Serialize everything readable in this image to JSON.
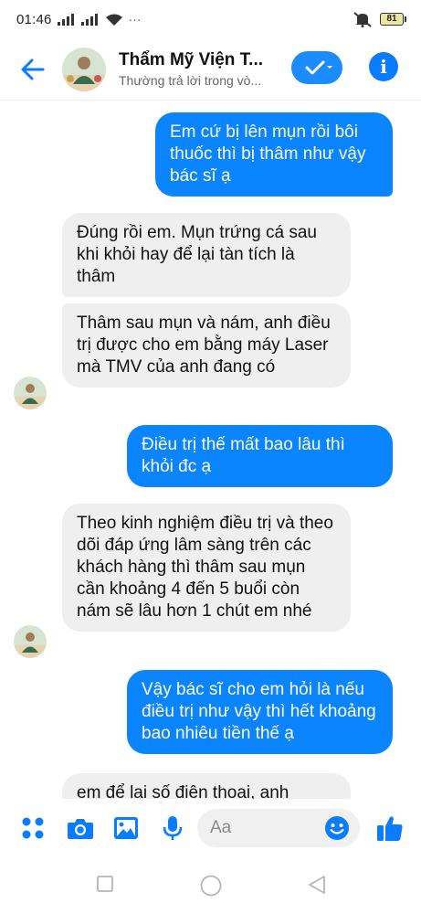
{
  "status_bar": {
    "time": "01:46",
    "dots": "···",
    "battery": "81"
  },
  "header": {
    "contact_name": "Thẩm Mỹ Viện T...",
    "contact_status": "Thường trả lời trong vò..."
  },
  "messages": [
    {
      "from": "me",
      "text": "Em cứ bị lên mụn rồi bôi thuốc thì bị thâm như vậy bác sĩ ạ"
    },
    {
      "from": "them",
      "text": "Đúng rồi em. Mụn trứng cá sau khi khỏi hay để lại tàn tích là thâm"
    },
    {
      "from": "them",
      "text": "Thâm sau mụn và nám, anh điều trị được cho em bằng máy Laser mà TMV của anh đang có"
    },
    {
      "from": "me",
      "text": "Điều trị thế mất bao lâu thì khỏi đc ạ"
    },
    {
      "from": "them",
      "text": "Theo kinh nghiệm điều trị và theo dõi đáp ứng lâm sàng trên các khách hàng thì thâm sau mụn cần khoảng 4 đến 5 buổi còn nám sẽ lâu hơn 1 chút em nhé"
    },
    {
      "from": "me",
      "text": "Vậy bác sĩ cho em hỏi là nếu điều trị như vậy thì hết khoảng bao nhiêu tiền thế ạ"
    },
    {
      "from": "them",
      "text": "em để lại số điện thoại, anh"
    }
  ],
  "composer": {
    "placeholder": "Aa"
  },
  "colors": {
    "accent": "#0a84ff",
    "incoming": "#efefef",
    "like": "#0a7cff"
  },
  "icons": [
    "back-arrow-icon",
    "video-call-icon",
    "info-icon",
    "apps-icon",
    "camera-icon",
    "gallery-icon",
    "microphone-icon",
    "emoji-icon",
    "thumbs-up-icon",
    "recent-apps-icon",
    "home-icon",
    "back-nav-icon"
  ]
}
